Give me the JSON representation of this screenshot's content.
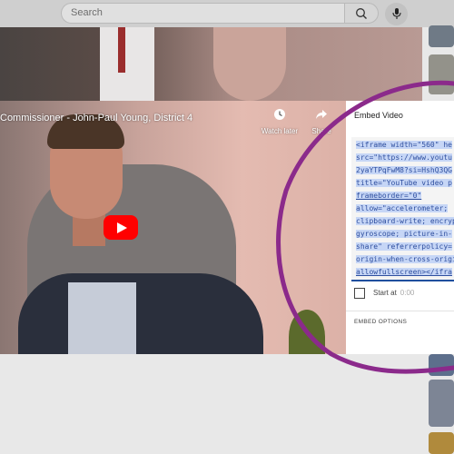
{
  "search": {
    "placeholder": "Search"
  },
  "video": {
    "title": "Commissioner - John-Paul Young, District 4",
    "watch_later_label": "Watch later",
    "share_label": "Share"
  },
  "embed_panel": {
    "title": "Embed Video",
    "code_lines": [
      "<iframe width=\"560\" he",
      "src=\"https://www.youtu",
      "2yaYTPqFwM8?si=HshQ3QG",
      "title=\"YouTube video p",
      "frameborder=\"0\"",
      "allow=\"accelerometer;",
      "clipboard-write; encryp",
      "gyroscope; picture-in-",
      "share\" referrerpolicy=",
      "origin-when-cross-origi",
      "allowfullscreen></ifra"
    ],
    "start_at_label": "Start at",
    "start_at_time": "0:00",
    "embed_options_label": "EMBED OPTIONS"
  },
  "colors": {
    "annotation": "#8b2a8b",
    "selection": "#c6d6f6",
    "code_text": "#2f4f9f",
    "youtube_red": "#ff0000"
  },
  "icons": [
    "search-icon",
    "microphone-icon",
    "clock-icon",
    "share-icon",
    "play-icon"
  ]
}
